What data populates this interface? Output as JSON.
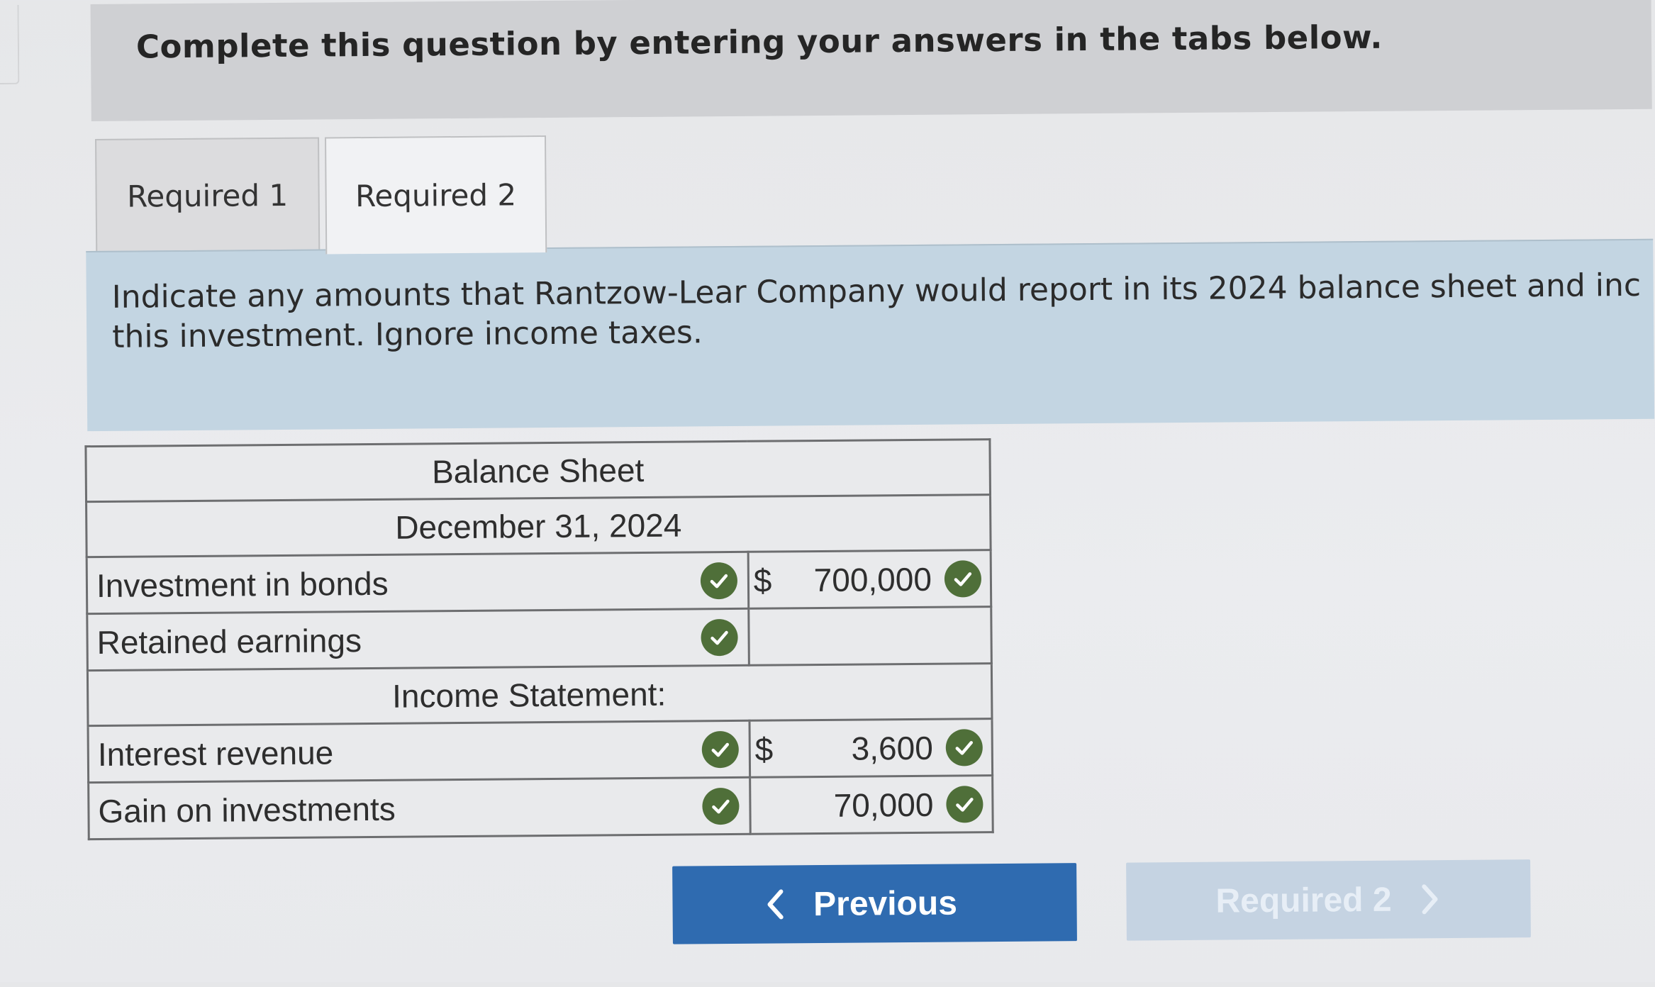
{
  "instruction": "Complete this question by entering your answers in the tabs below.",
  "tabs": [
    {
      "label": "Required 1"
    },
    {
      "label": "Required 2"
    }
  ],
  "prompt": {
    "line1": "Indicate any amounts that Rantzow-Lear Company would report in its 2024 balance sheet and inc",
    "line2": "this investment. Ignore income taxes."
  },
  "table": {
    "title": "Balance Sheet",
    "date": "December 31, 2024",
    "balance_rows": [
      {
        "label": "Investment in bonds",
        "currency": "$",
        "amount": "700,000",
        "label_correct": true,
        "value_correct": true
      },
      {
        "label": "Retained earnings",
        "currency": "",
        "amount": "",
        "label_correct": true,
        "value_correct": false
      }
    ],
    "income_header": "Income Statement:",
    "income_rows": [
      {
        "label": "Interest revenue",
        "currency": "$",
        "amount": "3,600",
        "label_correct": true,
        "value_correct": true
      },
      {
        "label": "Gain on investments",
        "currency": "",
        "amount": "70,000",
        "label_correct": true,
        "value_correct": true
      }
    ]
  },
  "nav": {
    "previous_label": "Previous",
    "next_label": "Required 2"
  },
  "colors": {
    "accent_blue": "#2f6bb0",
    "prompt_panel": "#c3d5e2",
    "check_green": "#4f6f39"
  }
}
